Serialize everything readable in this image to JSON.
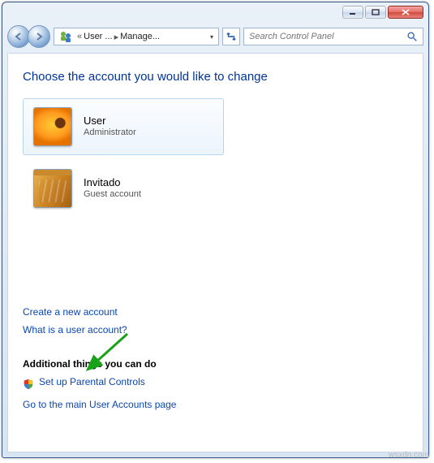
{
  "titlebar": {
    "minimize": "minimize",
    "maximize": "maximize",
    "close": "close"
  },
  "nav": {
    "back": "back",
    "forward": "forward",
    "crumb1": "User ...",
    "crumb2": "Manage...",
    "refresh_icon": "refresh-icon"
  },
  "search": {
    "placeholder": "Search Control Panel"
  },
  "heading": "Choose the account you would like to change",
  "accounts": [
    {
      "name": "User",
      "role": "Administrator"
    },
    {
      "name": "Invitado",
      "role": "Guest account"
    }
  ],
  "links": {
    "create": "Create a new account",
    "what": "What is a user account?"
  },
  "sub": {
    "heading": "Additional things you can do",
    "parental": "Set up Parental Controls",
    "main": "Go to the main User Accounts page"
  },
  "watermark": "wsxdn.com"
}
